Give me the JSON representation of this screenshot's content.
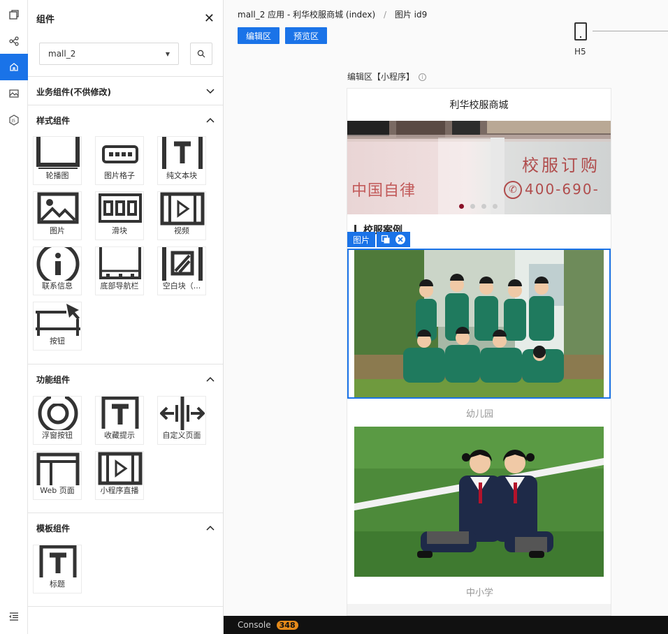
{
  "panel": {
    "title": "组件",
    "project_select": "mall_2"
  },
  "sections": {
    "business": {
      "title": "业务组件(不供修改)",
      "chevron": "chevron-down"
    },
    "style": {
      "title": "样式组件",
      "items": [
        "轮播图",
        "图片格子",
        "纯文本块",
        "图片",
        "滑块",
        "视频",
        "联系信息",
        "底部导航栏",
        "空白块（...",
        "按钮"
      ]
    },
    "function": {
      "title": "功能组件",
      "items": [
        "浮窗按钮",
        "收藏提示",
        "自定义页面",
        "Web 页面",
        "小程序直播"
      ]
    },
    "template": {
      "title": "模板组件",
      "items": [
        "标题"
      ]
    }
  },
  "breadcrumb": {
    "app": "mall_2 应用 - 利华校服商城 (index)",
    "sep": "/",
    "page": "图片 id9"
  },
  "toolbar": {
    "edit_label": "编辑区",
    "preview_label": "预览区",
    "device_label": "H5"
  },
  "editor": {
    "label": "编辑区【小程序】",
    "info_glyph": "i"
  },
  "phone": {
    "title": "利华校服商城",
    "banner_text_left": "中国自律",
    "banner_text_top": "校服订购",
    "banner_phone": "400-690-",
    "section_title": "校服案例",
    "selected_tag": "图片",
    "caption1": "幼儿园",
    "caption2": "中小学"
  },
  "console": {
    "label": "Console",
    "count": "348"
  },
  "colors": {
    "accent": "#1a73e8",
    "dot_active": "#8a1028",
    "badge": "#e58a1a"
  }
}
